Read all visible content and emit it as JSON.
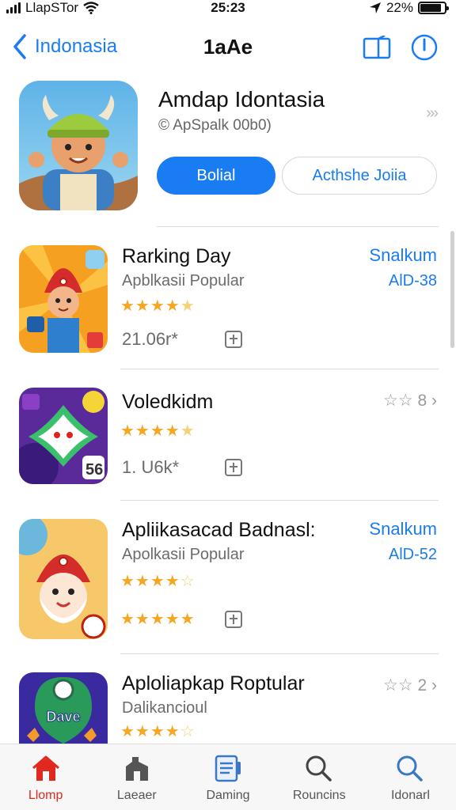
{
  "status": {
    "carrier": "LlapSTor",
    "time": "25:23",
    "battery": "22%",
    "battery_level": 0.85
  },
  "nav": {
    "back_label": "Indonasia",
    "title": "1aAe"
  },
  "featured": {
    "title": "Amdap Idontasia",
    "subtitle": "© ApSpalk 00b0)",
    "primary_button": "Bolial",
    "secondary_button": "Acthshe Joiia",
    "chevron": "»›"
  },
  "apps": [
    {
      "name": "Rarking Day",
      "category": "Apblkasii Popular",
      "stars": "★★★★",
      "half_star": "★",
      "count": "21.06r*",
      "action": "Snalkum",
      "price": "AlD-38"
    },
    {
      "name": "Voledkidm",
      "stars": "★★★★",
      "half_star": "★",
      "count": "1. U6k*",
      "rating_label": "☆☆ 8 ›"
    },
    {
      "name": "Apliikasacad Badnasl:",
      "category": "Apolkasii Popular",
      "stars": "★★★★",
      "half_star": "☆",
      "stars_second": "★★★★★",
      "action": "Snalkum",
      "price": "AlD-52"
    },
    {
      "name": "Aploliapkap Roptular",
      "category": "Dalikancioul",
      "stars": "★★★★",
      "half_star": "☆",
      "rating_label": "☆☆ 2 ›"
    }
  ],
  "icon_texts": {
    "app2_badge": "56",
    "app4_badge": "Dave"
  },
  "tabs": [
    {
      "label": "Llomp",
      "icon": "home-icon"
    },
    {
      "label": "Laeaer",
      "icon": "games-icon"
    },
    {
      "label": "Daming",
      "icon": "apps-icon"
    },
    {
      "label": "Rouncins",
      "icon": "search-icon"
    },
    {
      "label": "Idonarl",
      "icon": "search-icon"
    }
  ],
  "colors": {
    "accent": "#1a7cf2",
    "active_tab": "#e0281f",
    "star": "#f5a623"
  }
}
